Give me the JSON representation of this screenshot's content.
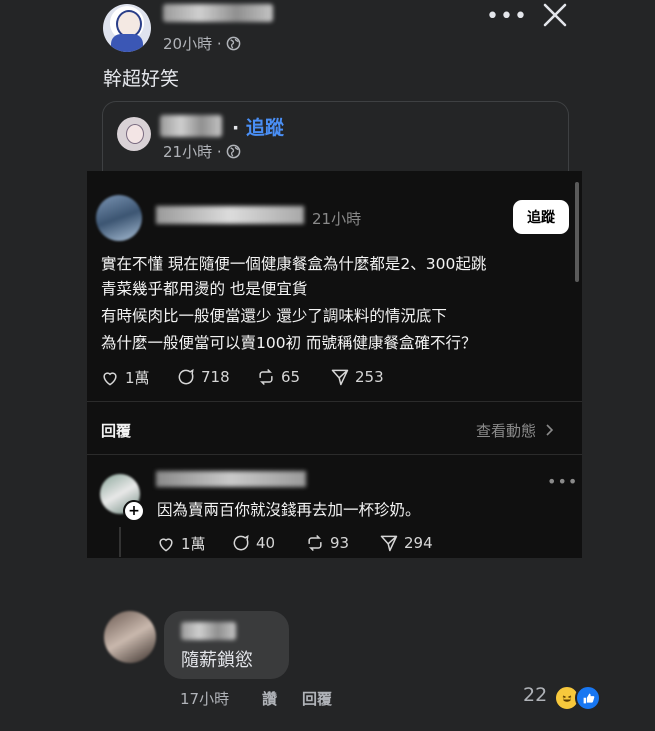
{
  "post": {
    "time": "20小時",
    "privacy_icon": "globe-icon",
    "text": "幹超好笑"
  },
  "shared": {
    "dot": "·",
    "follow_label": "追蹤",
    "time": "21小時"
  },
  "threads": {
    "time": "21小時",
    "follow_button": "追蹤",
    "lines": [
      "實在不懂 現在隨便一個健康餐盒為什麼都是2、300起跳",
      "青菜幾乎都用燙的 也是便宜貨",
      "有時候肉比一般便當還少 還少了調味料的情況底下",
      "為什麼一般便當可以賣100初 而號稱健康餐盒確不行？"
    ],
    "stats": {
      "likes": "1萬",
      "comments": "718",
      "reposts": "65",
      "shares": "253"
    },
    "replies_label": "回覆",
    "view_activity": "查看動態",
    "reply": {
      "text": "因為賣兩百你就沒錢再去加一杯珍奶。",
      "stats": {
        "likes": "1萬",
        "comments": "40",
        "reposts": "93",
        "shares": "294"
      }
    }
  },
  "comment": {
    "text": "隨薪鎖慾",
    "time": "17小時",
    "like_label": "讚",
    "reply_label": "回覆",
    "reaction_count": "22",
    "reaction_icons": [
      "haha-icon",
      "like-icon"
    ]
  },
  "colors": {
    "background": "#242526",
    "link": "#4a8ff5",
    "threads_background": "#101010",
    "bubble": "#3a3b3c"
  }
}
